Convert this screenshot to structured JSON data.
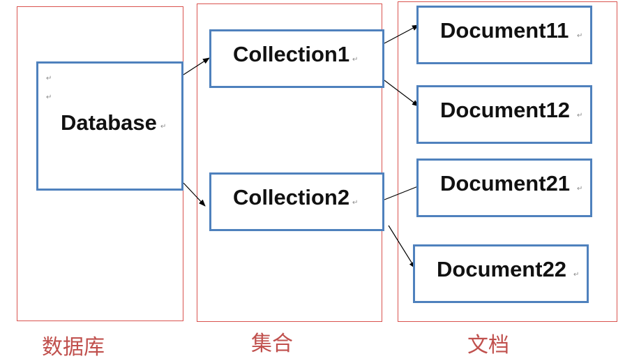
{
  "columns": {
    "database": {
      "caption": "数据库"
    },
    "collection": {
      "caption": "集合"
    },
    "document": {
      "caption": "文档"
    }
  },
  "nodes": {
    "database": {
      "label": "Database"
    },
    "collection1": {
      "label": "Collection1"
    },
    "collection2": {
      "label": "Collection2"
    },
    "document11": {
      "label": "Document11"
    },
    "document12": {
      "label": "Document12"
    },
    "document21": {
      "label": "Document21"
    },
    "document22": {
      "label": "Document22"
    }
  },
  "paragraph_mark": "↵",
  "colors": {
    "column_border": "#d9534f",
    "box_border": "#4f81bd",
    "caption": "#c0504d"
  }
}
